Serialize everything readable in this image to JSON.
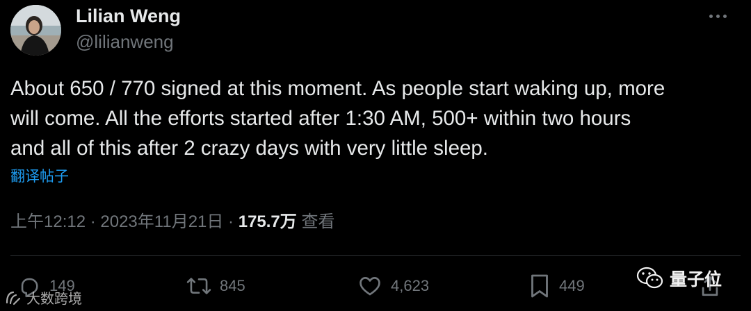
{
  "author": {
    "name": "Lilian Weng",
    "handle": "@lilianweng"
  },
  "tweet": {
    "text": "About 650 / 770 signed at this moment. As people start waking up, more\nwill come. All the efforts started after 1:30 AM, 500+ within two hours\nand all of this after 2 crazy days with very little sleep.",
    "translate_label": "翻译帖子",
    "timestamp": "上午12:12 · 2023年11月21日 · ",
    "views_count": "175.7万",
    "views_label": " 查看"
  },
  "actions": {
    "reply_count": "149",
    "retweet_count": "845",
    "like_count": "4,623",
    "bookmark_count": "449"
  },
  "watermarks": {
    "left": "大数跨境",
    "right": "量子位"
  },
  "colors": {
    "background": "#000000",
    "text": "#e7e9ea",
    "secondary": "#71767b",
    "link": "#1d9bf0",
    "divider": "#2f3336"
  }
}
